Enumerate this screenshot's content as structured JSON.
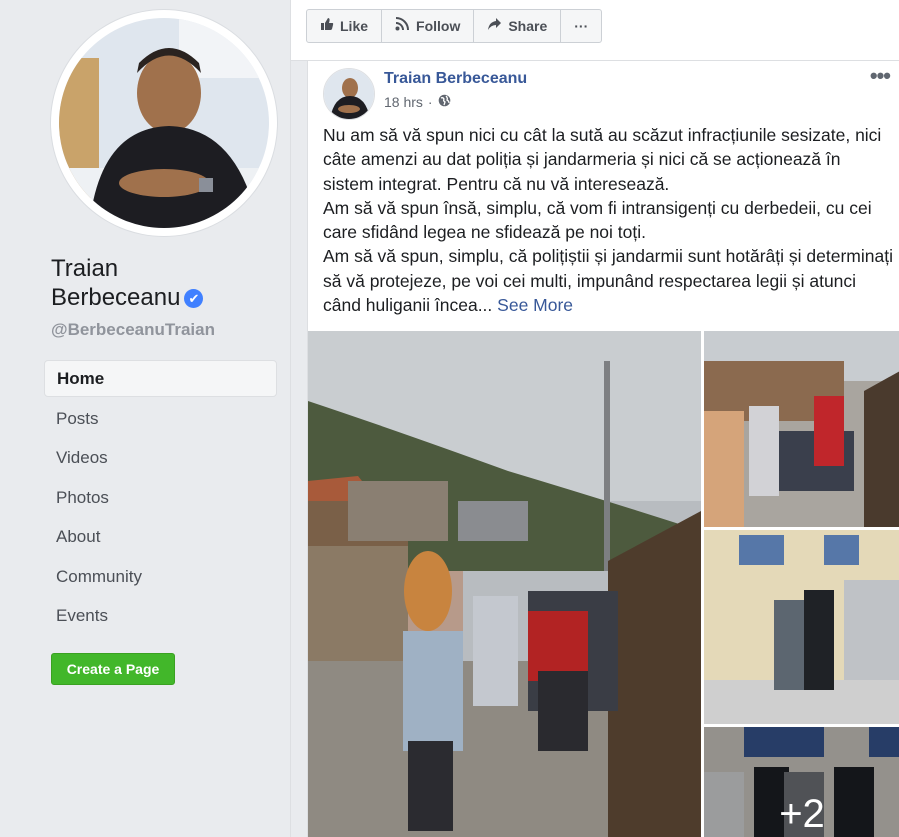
{
  "profile": {
    "name_line1": "Traian",
    "name_line2": "Berbeceanu",
    "verified_icon": "✔",
    "handle": "@BerbeceanuTraian"
  },
  "nav": {
    "items": [
      "Home",
      "Posts",
      "Videos",
      "Photos",
      "About",
      "Community",
      "Events"
    ],
    "active": "Home"
  },
  "create_page_label": "Create a Page",
  "actions": {
    "like": "Like",
    "follow": "Follow",
    "share": "Share",
    "more": "···"
  },
  "post": {
    "author": "Traian Berbeceanu",
    "time": "18 hrs",
    "separator": "·",
    "more": "•••",
    "paragraphs": [
      "Nu am să vă spun nici cu cât la sută au scăzut infracțiunile sesizate, nici câte amenzi au dat poliția și jandarmeria și nici că se acționează în sistem integrat. Pentru că nu vă interesează.",
      "Am să vă spun însă, simplu, că vom fi intransigenți cu derbedeii, cu cei care sfidând legea ne sfidează pe noi toți.",
      "Am să vă spun, simplu, că polițiștii și jandarmii sunt hotărâți și determinați să vă protejeze, pe voi cei multi, impunând respectarea legii și atunci când huliganii încea..."
    ],
    "see_more": "See More",
    "extra_photos": "+2"
  },
  "colors": {
    "link": "#385898",
    "green": "#42b72a",
    "verified": "#4080ff"
  }
}
